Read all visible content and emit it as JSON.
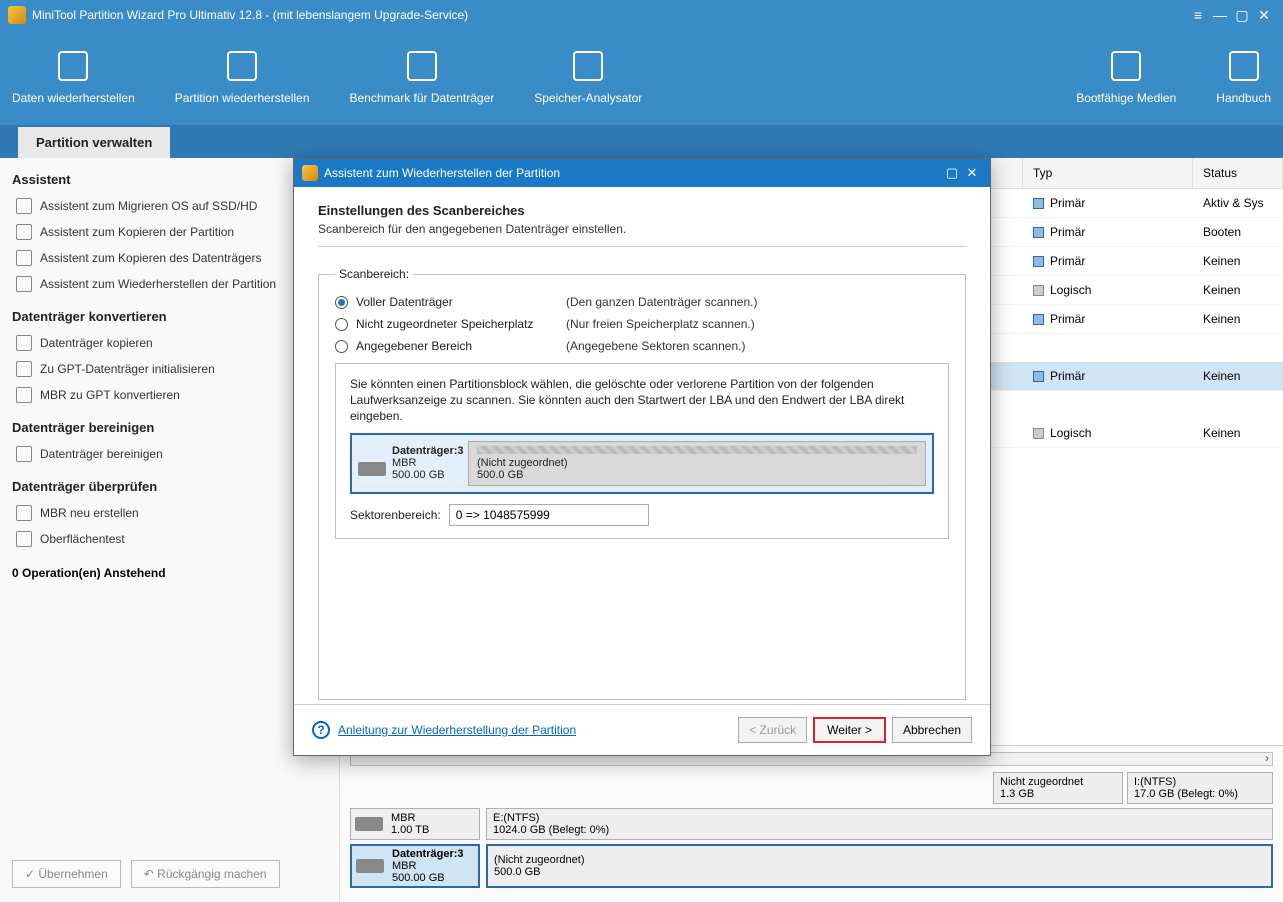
{
  "app": {
    "title": "MiniTool Partition Wizard Pro Ultimativ 12.8 - (mit lebenslangem Upgrade-Service)"
  },
  "toolbar": {
    "recover_data": "Daten wiederherstellen",
    "recover_partition": "Partition wiederherstellen",
    "benchmark": "Benchmark für Datenträger",
    "analyzer": "Speicher-Analysator",
    "bootmedia": "Bootfähige Medien",
    "manual": "Handbuch"
  },
  "tabs": {
    "manage": "Partition verwalten"
  },
  "sidebar": {
    "h_assistant": "Assistent",
    "a1": "Assistent zum Migrieren OS auf SSD/HD",
    "a2": "Assistent zum Kopieren der Partition",
    "a3": "Assistent zum Kopieren des Datenträgers",
    "a4": "Assistent zum Wiederherstellen der Partition",
    "h_convert": "Datenträger konvertieren",
    "c1": "Datenträger kopieren",
    "c2": "Zu GPT-Datenträger initialisieren",
    "c3": "MBR zu GPT konvertieren",
    "h_clean": "Datenträger bereinigen",
    "cl1": "Datenträger bereinigen",
    "h_check": "Datenträger überprüfen",
    "ch1": "MBR neu erstellen",
    "ch2": "Oberflächentest",
    "pending": "0 Operation(en) Anstehend",
    "apply": "Übernehmen",
    "undo": "Rückgängig machen"
  },
  "table": {
    "col_typ": "Typ",
    "col_status": "Status",
    "rows": [
      {
        "typ": "Primär",
        "status": "Aktiv & Sys",
        "sq": "blue"
      },
      {
        "typ": "Primär",
        "status": "Booten",
        "sq": "blue"
      },
      {
        "typ": "Primär",
        "status": "Keinen",
        "sq": "blue"
      },
      {
        "typ": "Logisch",
        "status": "Keinen",
        "sq": "gray"
      },
      {
        "typ": "Primär",
        "status": "Keinen",
        "sq": "blue"
      },
      {
        "typ": "Primär",
        "status": "Keinen",
        "sq": "blue",
        "gap": true
      },
      {
        "typ": "Logisch",
        "status": "Keinen",
        "sq": "gray",
        "gap": true
      }
    ]
  },
  "lower": {
    "t1": {
      "name": "Nicht zugeordnet",
      "size": "1.3 GB"
    },
    "t2": {
      "name": "I:(NTFS)",
      "size": "17.0 GB (Belegt: 0%)"
    },
    "d2": {
      "label": "MBR",
      "size": "1.00 TB"
    },
    "d2r": {
      "name": "E:(NTFS)",
      "size": "1024.0 GB (Belegt: 0%)"
    },
    "d3": {
      "label": "Datenträger:3",
      "mbr": "MBR",
      "size": "500.00 GB"
    },
    "d3r": {
      "name": "(Nicht zugeordnet)",
      "size": "500.0 GB"
    }
  },
  "modal": {
    "title": "Assistent zum Wiederherstellen der Partition",
    "h": "Einstellungen des Scanbereiches",
    "sub": "Scanbereich für den angegebenen Datenträger einstellen.",
    "legend": "Scanbereich:",
    "r1a": "Voller Datenträger",
    "r1b": "(Den ganzen Datenträger scannen.)",
    "r2a": "Nicht zugeordneter Speicherplatz",
    "r2b": "(Nur freien Speicherplatz scannen.)",
    "r3a": "Angegebener Bereich",
    "r3b": "(Angegebene Sektoren scannen.)",
    "info": "Sie könnten einen Partitionsblock wählen, die gelöschte oder verlorene Partition von der folgenden Laufwerksanzeige zu scannen. Sie könnten auch den Startwert der LBA und den Endwert der LBA direkt eingeben.",
    "disk": {
      "label": "Datenträger:3",
      "mbr": "MBR",
      "size": "500.00 GB",
      "rname": "(Nicht zugeordnet)",
      "rsize": "500.0 GB"
    },
    "sector_lbl": "Sektorenbereich:",
    "sector_val": "0 => 1048575999",
    "help": "Anleitung zur Wiederherstellung der Partition",
    "back": "< Zurück",
    "next": "Weiter >",
    "cancel": "Abbrechen"
  }
}
